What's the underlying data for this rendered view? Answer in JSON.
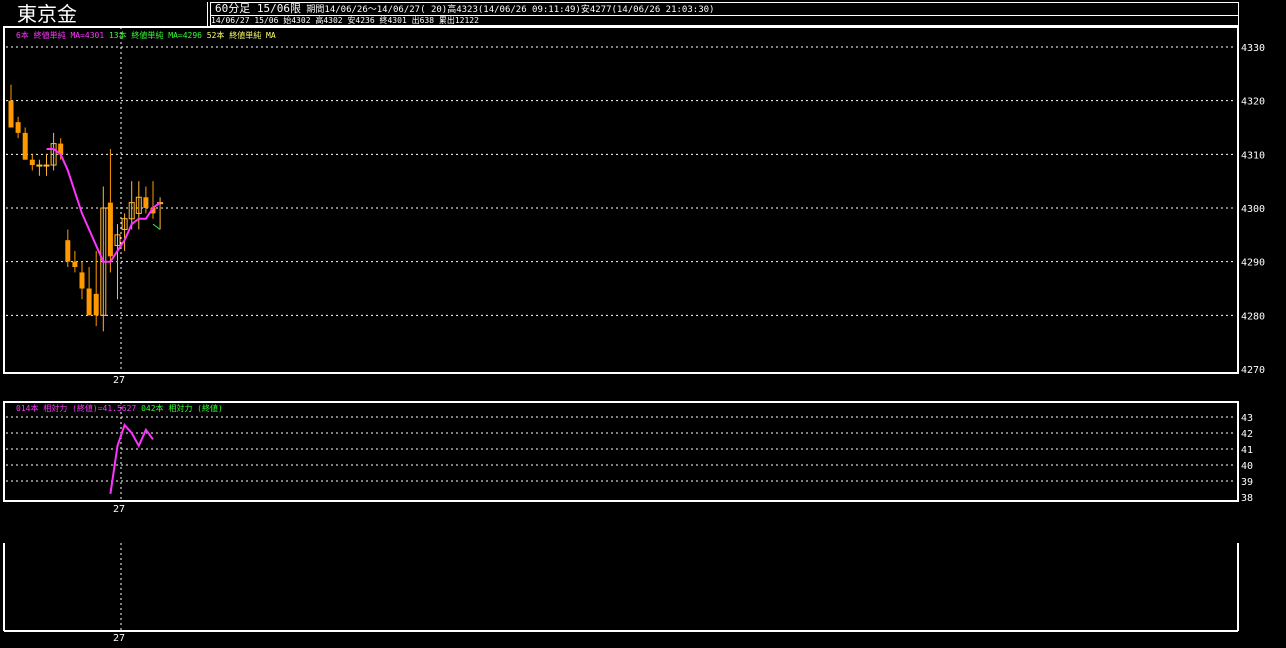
{
  "header": {
    "title": "東京金",
    "info_timeframe": "60分足 15/06限",
    "info_period": "期間14/06/26～14/06/27( 20)高4323(14/06/26 09:11:49)安4277(14/06/26 21:03:30)",
    "info_quote": "14/06/27 15/06 始4302 高4302 安4236 終4301 出638 累出12122"
  },
  "price_panel": {
    "legend": [
      {
        "text": "6本 終値単純 MA=4301",
        "color": "#ff33ff"
      },
      {
        "text": "13本 終値単純 MA=4296",
        "color": "#33ff33"
      },
      {
        "text": "52本 終値単純 MA",
        "color": "#ffff66"
      }
    ],
    "y_ticks": [
      "4330",
      "4320",
      "4310",
      "4300",
      "4290",
      "4280",
      "4270"
    ],
    "x_label": "27"
  },
  "indicator_panel": {
    "legend": [
      {
        "text": "014本 相対力 (終値)=41.5627",
        "color": "#ff33ff"
      },
      {
        "text": "042本 相対力 (終値)",
        "color": "#33ff33"
      }
    ],
    "y_ticks": [
      "43",
      "42",
      "41",
      "40",
      "39",
      "38"
    ],
    "x_label": "27"
  },
  "bottom_panel": {
    "x_label": "27"
  },
  "colors": {
    "up_candle": "#ffb833",
    "down_candle": "#ff9900",
    "ma6": "#ff33ff",
    "ma13": "#33ff33",
    "grid": "#ffffff",
    "rsi": "#ff33ff"
  },
  "chart_data": [
    {
      "type": "candlestick",
      "ylim": [
        4270,
        4330
      ],
      "candles": [
        {
          "open": 4320,
          "high": 4323,
          "low": 4315,
          "close": 4315
        },
        {
          "open": 4316,
          "high": 4317,
          "low": 4313,
          "close": 4314
        },
        {
          "open": 4314,
          "high": 4315,
          "low": 4309,
          "close": 4309
        },
        {
          "open": 4309,
          "high": 4310,
          "low": 4307,
          "close": 4308
        },
        {
          "open": 4308,
          "high": 4309,
          "low": 4306,
          "close": 4308
        },
        {
          "open": 4308,
          "high": 4310,
          "low": 4306,
          "close": 4308
        },
        {
          "open": 4308,
          "high": 4314,
          "low": 4307,
          "close": 4312
        },
        {
          "open": 4312,
          "high": 4313,
          "low": 4309,
          "close": 4310
        },
        {
          "open": 4294,
          "high": 4296,
          "low": 4289,
          "close": 4290
        },
        {
          "open": 4290,
          "high": 4292,
          "low": 4288,
          "close": 4289
        },
        {
          "open": 4288,
          "high": 4290,
          "low": 4283,
          "close": 4285
        },
        {
          "open": 4285,
          "high": 4289,
          "low": 4280,
          "close": 4280
        },
        {
          "open": 4284,
          "high": 4292,
          "low": 4278,
          "close": 4280
        },
        {
          "open": 4280,
          "high": 4304,
          "low": 4277,
          "close": 4300
        },
        {
          "open": 4301,
          "high": 4311,
          "low": 4288,
          "close": 4291
        },
        {
          "open": 4293,
          "high": 4297,
          "low": 4283,
          "close": 4295
        },
        {
          "open": 4296,
          "high": 4299,
          "low": 4292,
          "close": 4298
        },
        {
          "open": 4298,
          "high": 4305,
          "low": 4296,
          "close": 4301
        },
        {
          "open": 4299,
          "high": 4305,
          "low": 4296,
          "close": 4302
        },
        {
          "open": 4302,
          "high": 4304,
          "low": 4299,
          "close": 4300
        },
        {
          "open": 4300,
          "high": 4305,
          "low": 4298,
          "close": 4299
        },
        {
          "open": 4301,
          "high": 4302,
          "low": 4296,
          "close": 4301
        }
      ],
      "series": [
        {
          "name": "6本 終値単純 MA",
          "values": [
            null,
            null,
            null,
            null,
            null,
            4311,
            4311,
            4310,
            4307,
            4303,
            4299,
            4296,
            4293,
            4290,
            4290,
            4292,
            4294,
            4297,
            4298,
            4298,
            4300,
            4301
          ]
        },
        {
          "name": "13本 終値単純 MA",
          "values": [
            null,
            null,
            null,
            null,
            null,
            null,
            null,
            null,
            null,
            null,
            null,
            null,
            null,
            null,
            null,
            null,
            null,
            null,
            null,
            null,
            4297,
            4296
          ]
        }
      ]
    },
    {
      "type": "line",
      "ylim": [
        38,
        43.5
      ],
      "series": [
        {
          "name": "014本 相対力 (終値)",
          "values": [
            null,
            null,
            null,
            null,
            null,
            null,
            null,
            null,
            null,
            null,
            null,
            null,
            null,
            null,
            38.2,
            41.2,
            42.5,
            42.0,
            41.2,
            42.2,
            41.6
          ]
        }
      ]
    }
  ]
}
